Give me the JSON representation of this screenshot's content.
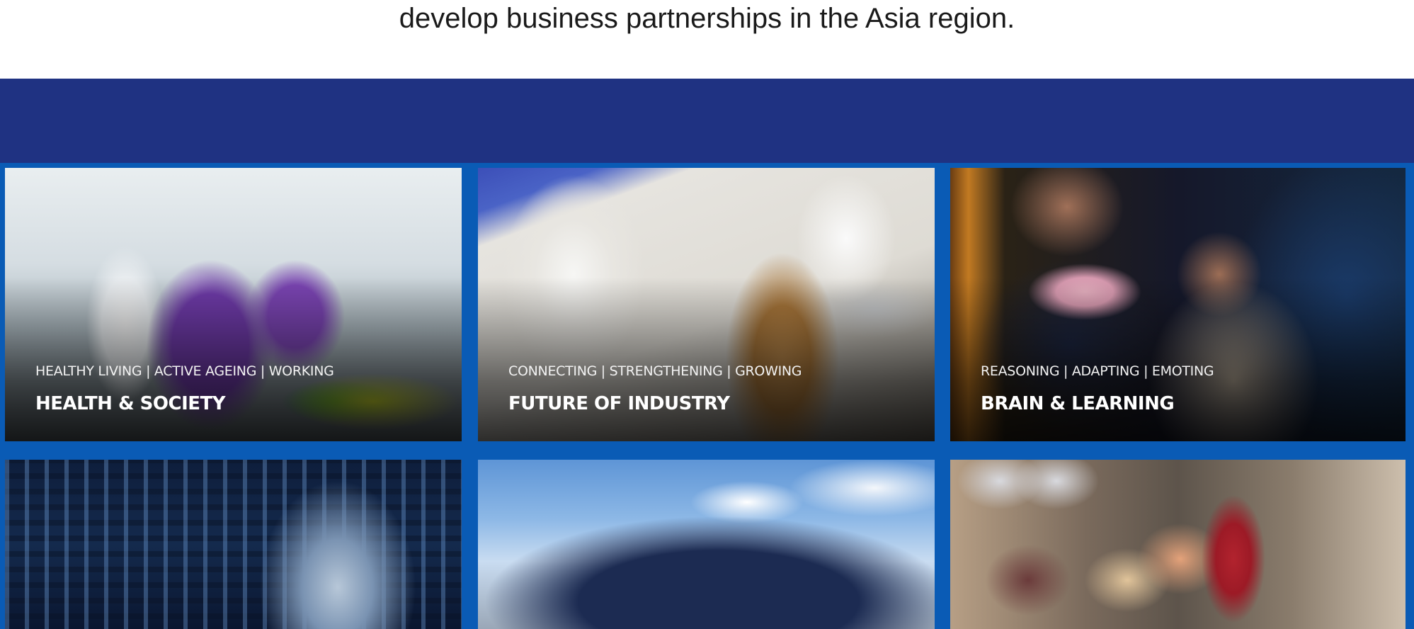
{
  "intro": {
    "text": "develop business partnerships in the Asia region."
  },
  "colors": {
    "band": "#1f3282",
    "grid_gap": "#0a5bb5"
  },
  "tiles": [
    {
      "tagline": "HEALTHY LIVING | ACTIVE AGEING | WORKING",
      "title": "HEALTH & SOCIETY",
      "image": "lab-researchers-photo"
    },
    {
      "tagline": "CONNECTING | STRENGTHENING | GROWING",
      "title": "FUTURE OF INDUSTRY",
      "image": "robot-arm-photo"
    },
    {
      "tagline": "REASONING | ADAPTING | EMOTING",
      "title": "BRAIN & LEARNING",
      "image": "eeg-cap-photo"
    },
    {
      "tagline": "",
      "title": "",
      "image": "digital-head-photo"
    },
    {
      "tagline": "",
      "title": "",
      "image": "autonomous-bus-photo"
    },
    {
      "tagline": "",
      "title": "",
      "image": "students-classroom-photo"
    }
  ]
}
